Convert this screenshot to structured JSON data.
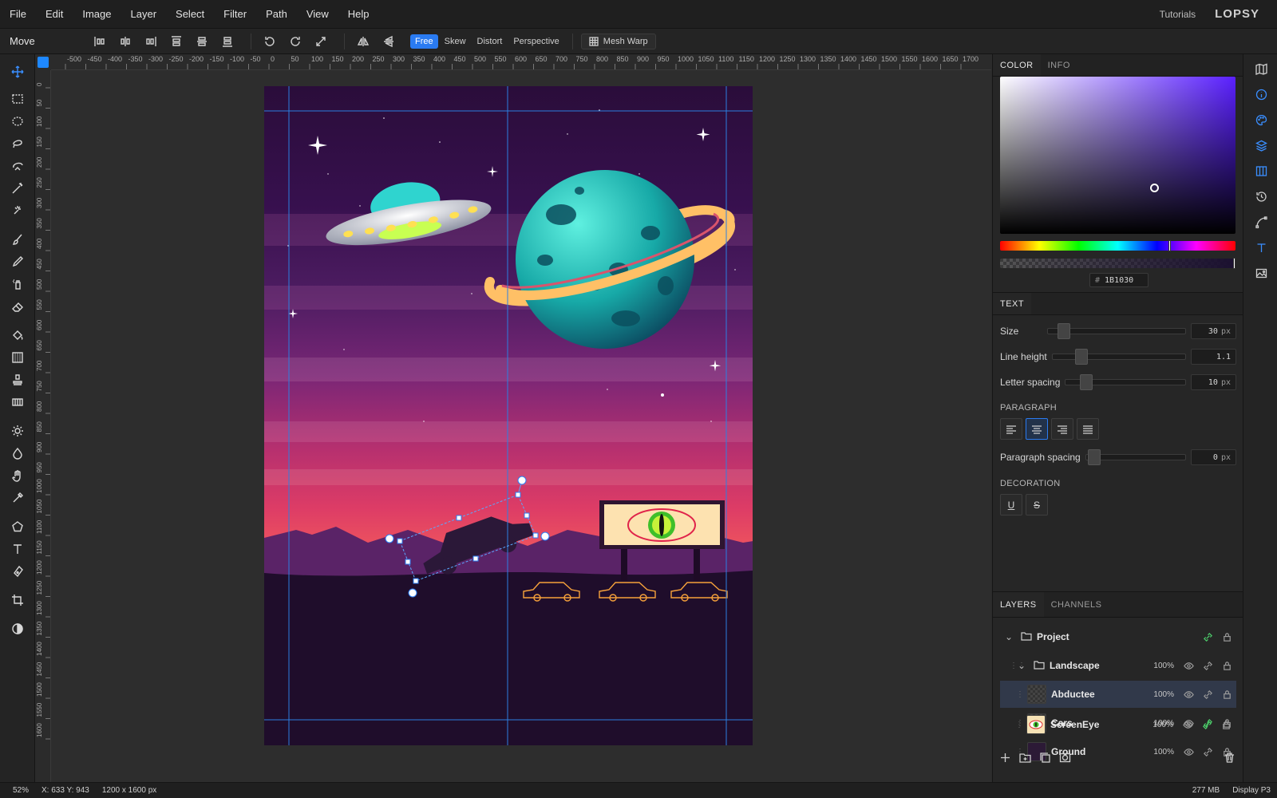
{
  "menu": [
    "File",
    "Edit",
    "Image",
    "Layer",
    "Select",
    "Filter",
    "Path",
    "View",
    "Help"
  ],
  "menu_right": {
    "tutorials": "Tutorials",
    "logo": "LOPSY"
  },
  "tool_options": {
    "tool_name": "Move",
    "modes": [
      "Free",
      "Skew",
      "Distort",
      "Perspective"
    ],
    "active_mode": "Free",
    "mesh_warp": "Mesh Warp"
  },
  "ruler": {
    "top": [
      "-500",
      "-450",
      "-400",
      "-350",
      "-300",
      "-250",
      "-200",
      "-150",
      "-100",
      "-50",
      "0",
      "50",
      "100",
      "150",
      "200",
      "250",
      "300",
      "350",
      "400",
      "450",
      "500",
      "550",
      "600",
      "650",
      "700",
      "750",
      "800",
      "850",
      "900",
      "950",
      "1000",
      "1050",
      "1100",
      "1150",
      "1200",
      "1250",
      "1300",
      "1350",
      "1400",
      "1450",
      "1500",
      "1550",
      "1600",
      "1650",
      "1700"
    ],
    "left": [
      "0",
      "50",
      "100",
      "150",
      "200",
      "250",
      "300",
      "350",
      "400",
      "450",
      "500",
      "550",
      "600",
      "650",
      "700",
      "750",
      "800",
      "850",
      "900",
      "950",
      "1000",
      "1050",
      "1100",
      "1150",
      "1200",
      "1250",
      "1300",
      "1350",
      "1400",
      "1450",
      "1500",
      "1550",
      "1600"
    ]
  },
  "color_panel": {
    "tabs": [
      "COLOR",
      "INFO"
    ],
    "hex": "1B1030",
    "hash": "#"
  },
  "text_panel": {
    "title": "TEXT",
    "size": {
      "label": "Size",
      "value": "30",
      "unit": "px"
    },
    "line_height": {
      "label": "Line height",
      "value": "1.1"
    },
    "letter_spacing": {
      "label": "Letter spacing",
      "value": "10",
      "unit": "px"
    },
    "paragraph_label": "PARAGRAPH",
    "paragraph_spacing": {
      "label": "Paragraph spacing",
      "value": "0",
      "unit": "px"
    },
    "decoration_label": "DECORATION",
    "decoration": [
      "U",
      "S"
    ]
  },
  "layers_panel": {
    "tabs": [
      "LAYERS",
      "CHANNELS"
    ],
    "project": "Project",
    "group": {
      "name": "Landscape",
      "opacity": "100%"
    },
    "layers": [
      {
        "name": "Abductee",
        "opacity": "100%"
      },
      {
        "name": "Cars",
        "opacity": "100%"
      },
      {
        "name": "Ground",
        "opacity": "100%"
      },
      {
        "name": "ScreenEye",
        "opacity": "100%"
      }
    ]
  },
  "status": {
    "zoom": "52%",
    "coords": "X: 633 Y: 943",
    "dims": "1200 x 1600 px",
    "memory": "277 MB",
    "profile": "Display P3"
  },
  "colors": {
    "accent": "#2a7bf2",
    "selected_row": "#31394a",
    "lock_on": "#4ccd6a"
  }
}
